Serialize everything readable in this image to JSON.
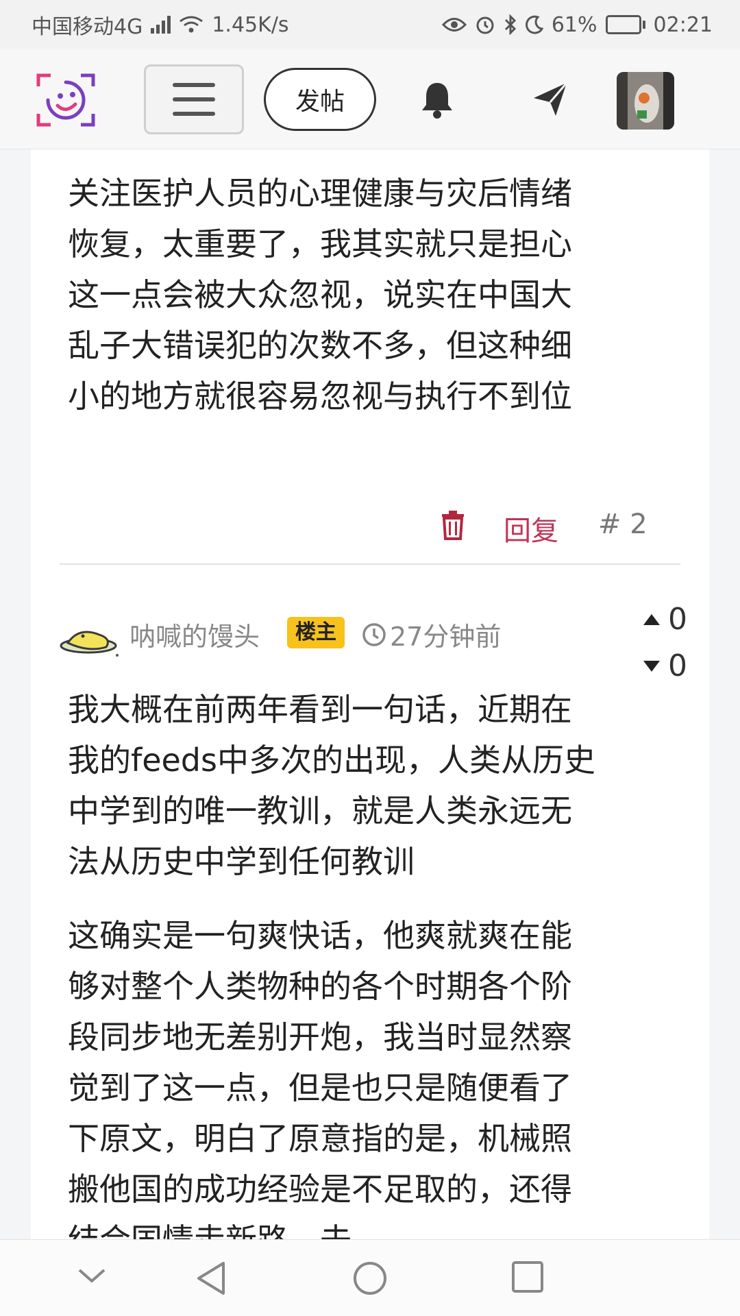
{
  "status_bar": {
    "carrier": "中国移动4G",
    "network_badge": "4G",
    "speed": "1.45K/s",
    "battery": "61%",
    "battery_level": 0.61,
    "time": "02:21"
  },
  "header": {
    "logo_icon": "smiley-logo",
    "menu_icon": "hamburger-menu-icon",
    "post_button_label": "发帖",
    "notification_icon": "bell-icon",
    "messages_icon": "send-icon"
  },
  "post": {
    "paragraphs": [
      "关注医护人员的心理健康与灾后情绪恢复，太重要了，我其实就只是担心这一点会被大众忽视，说实在中国大乱子大错误犯的次数不多，但这种细小的地方就很容易忽视与执行不到位"
    ],
    "reply_label": "回复",
    "floor_label": "# 2"
  },
  "comment": {
    "username": "呐喊的馒头",
    "op_badge": "楼主",
    "time_ago": "27分钟前",
    "upvotes": "0",
    "downvotes": "0",
    "paragraphs": [
      "我大概在前两年看到一句话，近期在我的feeds中多次的出现，人类从历史中学到的唯一教训，就是人类永远无法从历史中学到任何教训",
      "这确实是一句爽快话，他爽就爽在能够对整个人类物种的各个时期各个阶段同步地无差别开炮，我当时显然察觉到了这一点，但是也只是随便看了下原文，明白了原意指的是，机械照搬他国的成功经验是不足取的，还得结合国情走新路，去"
    ]
  },
  "colors": {
    "accent_red": "#c0345a",
    "badge_yellow": "#f7c21c",
    "logo_purple": "#7b3fbf",
    "logo_pink": "#e23c7c"
  }
}
